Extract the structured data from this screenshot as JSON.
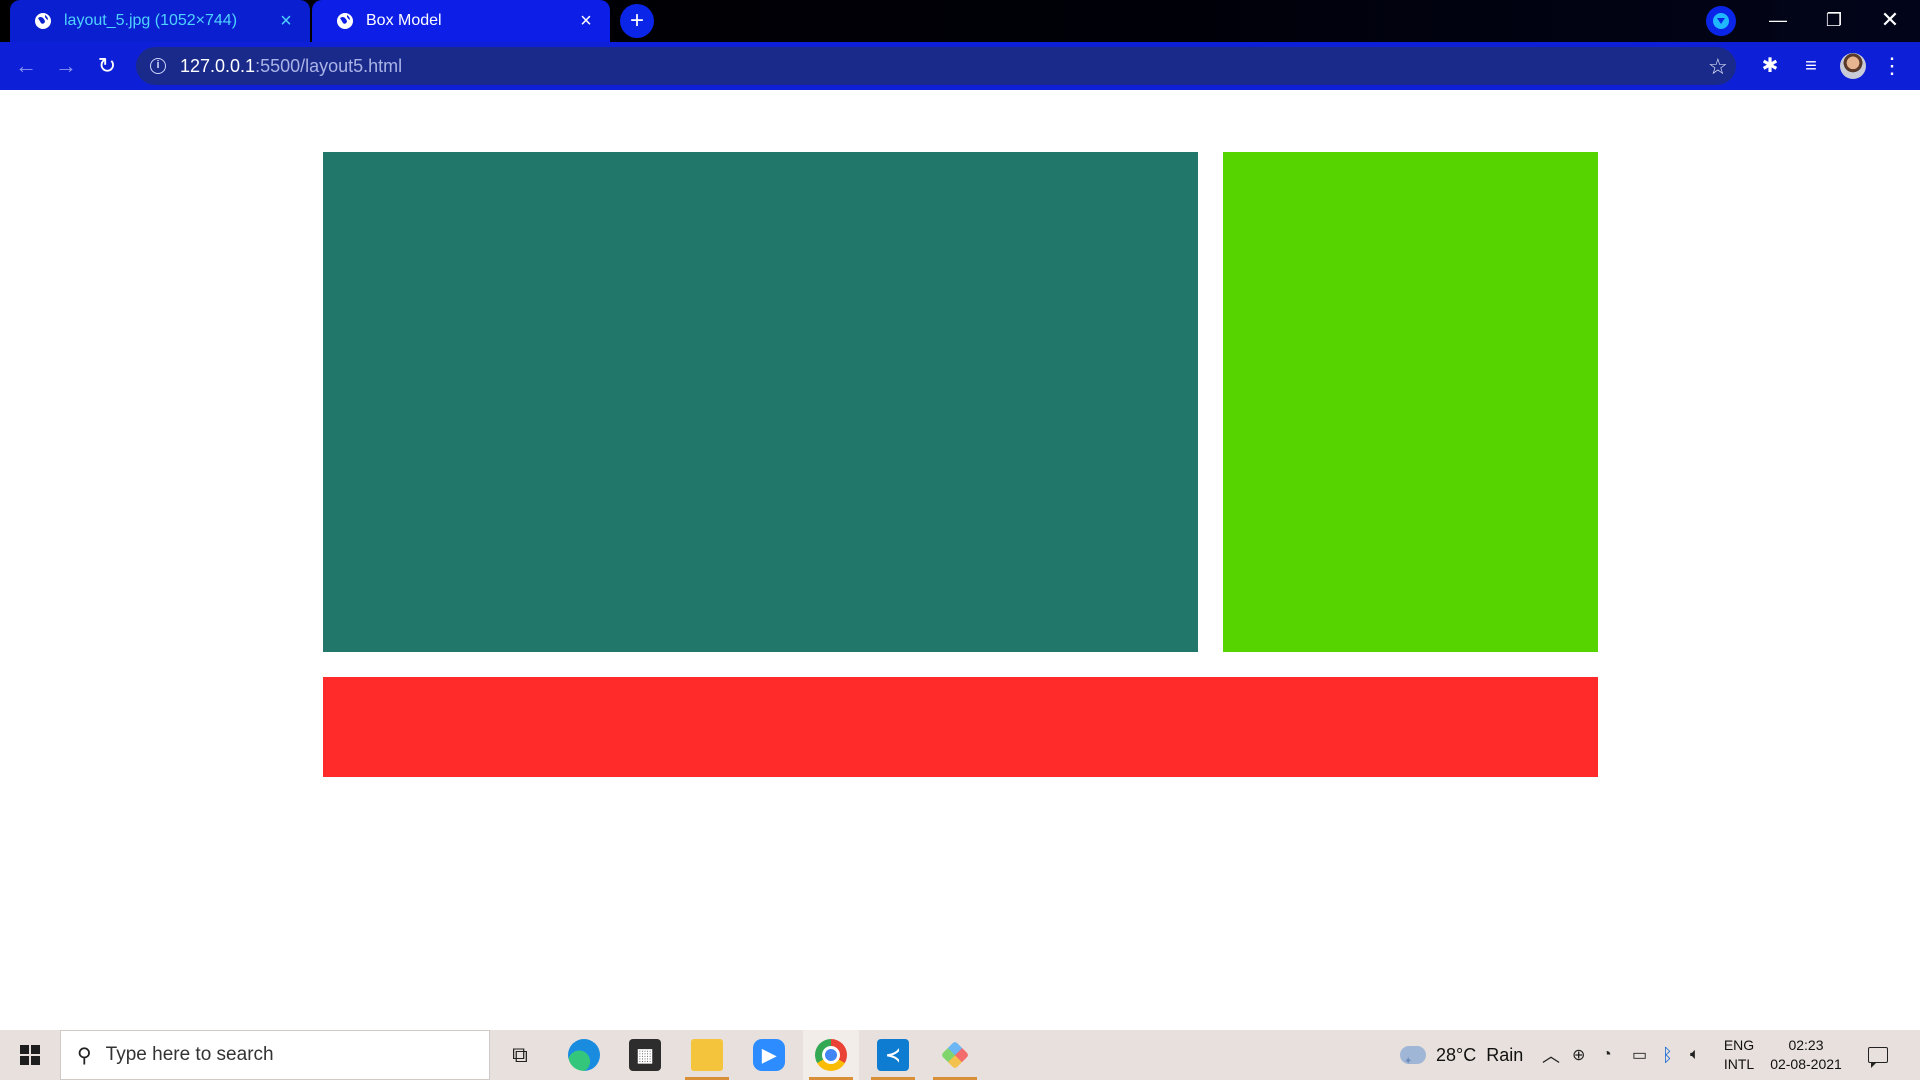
{
  "browser": {
    "tabs": [
      {
        "title": "layout_5.jpg (1052×744)",
        "active": false
      },
      {
        "title": "Box Model",
        "active": true
      }
    ],
    "new_tab_icon": "plus-icon",
    "address": {
      "host": "127.0.0.1",
      "path": ":5500/layout5.html"
    },
    "window_controls": {
      "minimize": "—",
      "maximize": "❐",
      "close": "✕"
    }
  },
  "page": {
    "boxes": [
      {
        "name": "main",
        "color": "#21786a"
      },
      {
        "name": "side",
        "color": "#55d400"
      },
      {
        "name": "footer",
        "color": "#ff2a2a"
      }
    ]
  },
  "taskbar": {
    "search_placeholder": "Type here to search",
    "apps": [
      "task-view",
      "edge",
      "microsoft-store",
      "file-explorer",
      "zoom",
      "chrome",
      "vscode",
      "git"
    ],
    "weather": {
      "temp": "28°C",
      "condition": "Rain"
    },
    "language": {
      "line1": "ENG",
      "line2": "INTL"
    },
    "clock": {
      "time": "02:23",
      "date": "02-08-2021"
    }
  }
}
